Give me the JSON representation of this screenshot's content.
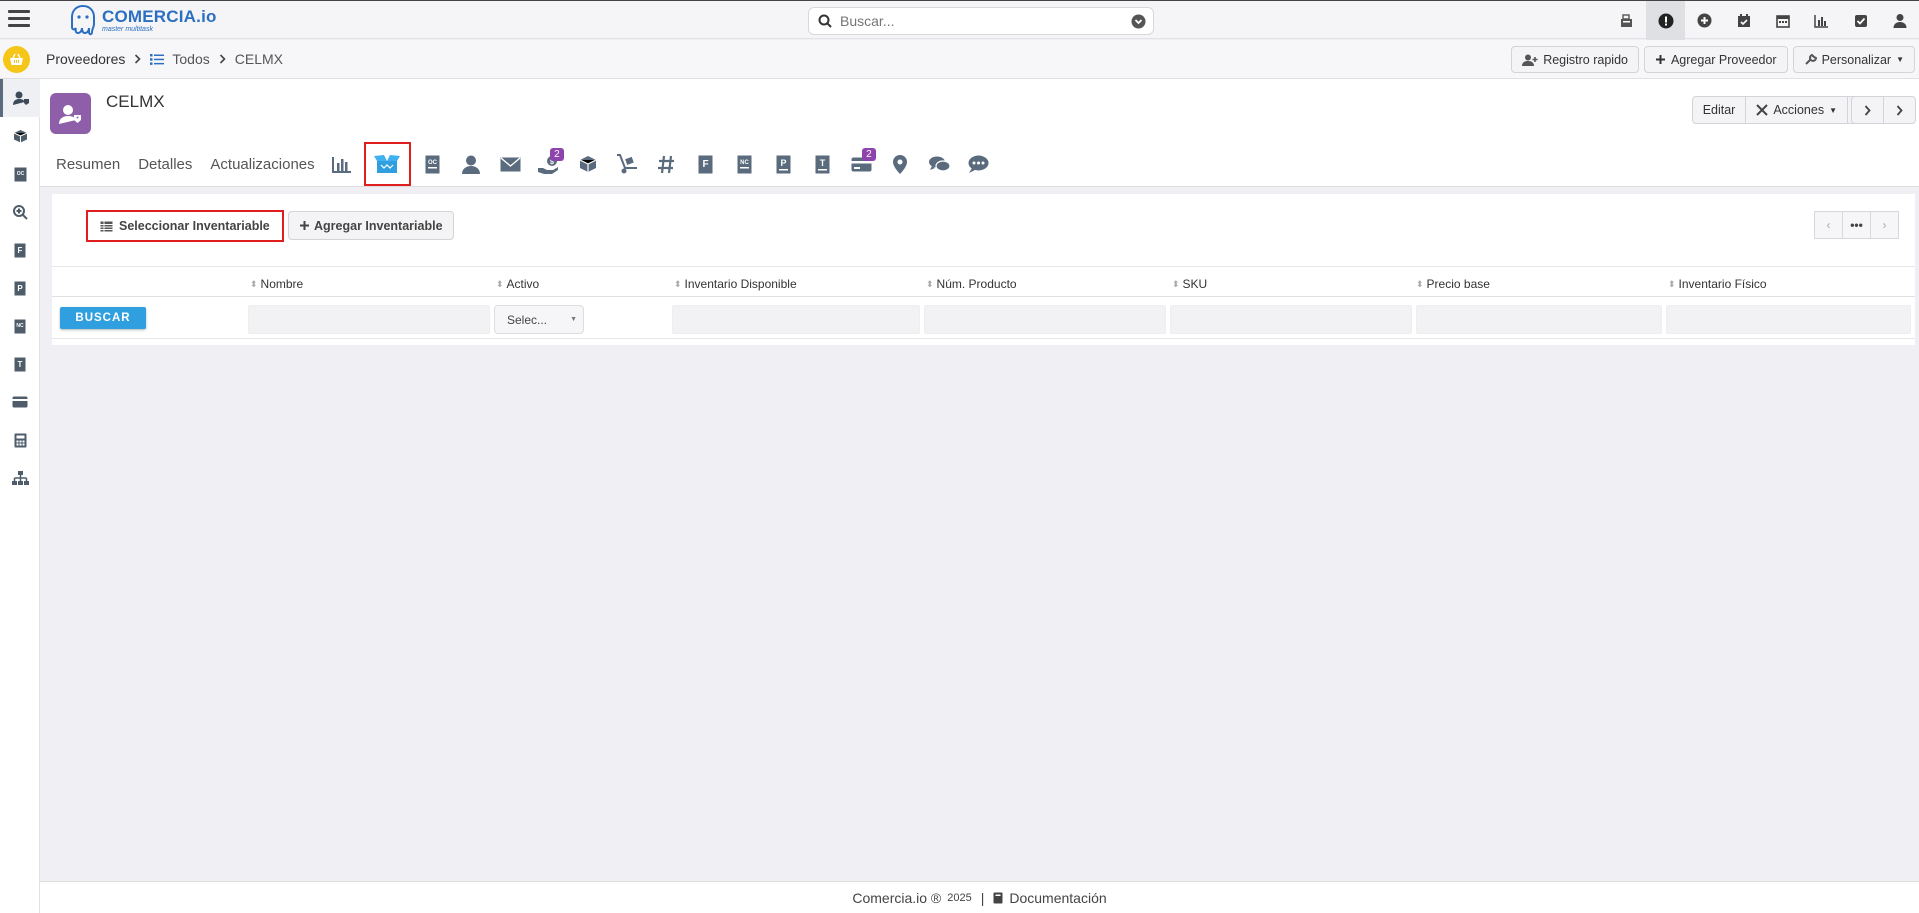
{
  "app": {
    "brand": "COMERCIA.io",
    "tagline": "master multitask"
  },
  "search": {
    "placeholder": "Buscar..."
  },
  "top_icons": [
    "cash-register-icon",
    "alert-icon",
    "plus-circle-icon",
    "calendar-check-icon",
    "calendar-icon",
    "chart-icon",
    "checkbox-icon",
    "user-icon"
  ],
  "breadcrumb": {
    "root": "Proveedores",
    "list": "Todos",
    "current": "CELMX"
  },
  "subbar_buttons": {
    "quick": "Registro rapido",
    "add": "Agregar Proveedor",
    "customize": "Personalizar"
  },
  "record": {
    "title": "CELMX",
    "edit": "Editar",
    "actions": "Acciones"
  },
  "tabs": {
    "summary": "Resumen",
    "details": "Detalles",
    "updates": "Actualizaciones",
    "badge_payments": "2",
    "badge_cards": "2"
  },
  "inventory": {
    "select_label": "Seleccionar Inventariable",
    "add_label": "Agregar Inventariable"
  },
  "table": {
    "columns": [
      "Nombre",
      "Activo",
      "Inventario Disponible",
      "Núm. Producto",
      "SKU",
      "Precio base",
      "Inventario Físico"
    ],
    "search_button": "BUSCAR",
    "select_placeholder": "Selec..."
  },
  "footer": {
    "brand": "Comercia.io ®",
    "year": "2025",
    "separator": "|",
    "docs": "Documentación"
  },
  "colors": {
    "brand": "#2c6fc1",
    "avatar": "#8e5fa8",
    "highlight": "#e01e1e",
    "button": "#2f9fe0",
    "badge": "#8e44ad"
  }
}
